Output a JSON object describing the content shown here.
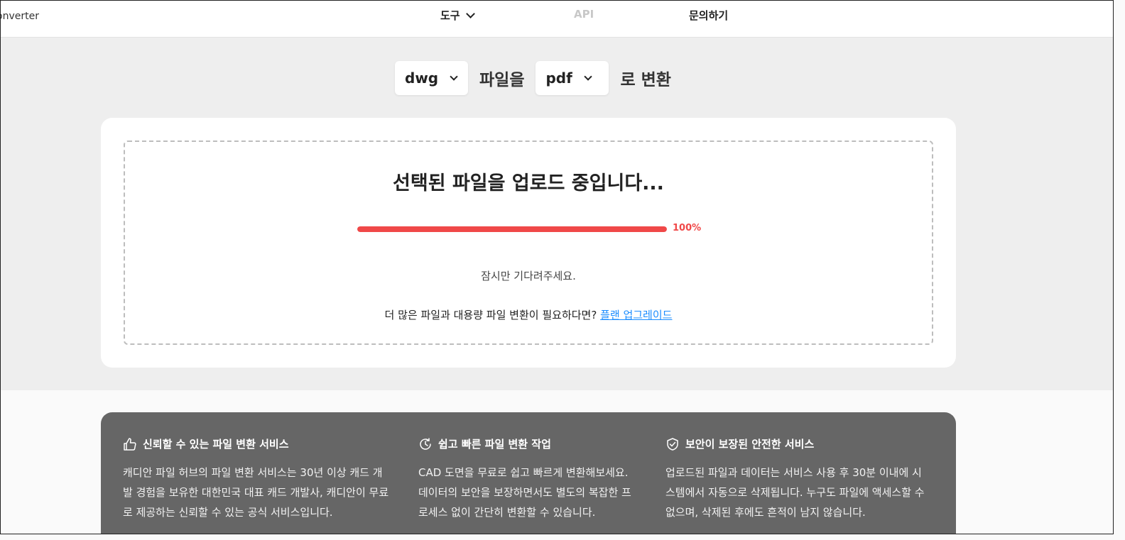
{
  "topbar": {
    "brand": "onverter",
    "nav": [
      {
        "label": "도구"
      },
      {
        "label": "API"
      },
      {
        "label": "문의하기"
      }
    ]
  },
  "converter": {
    "from_format": "dwg",
    "middle_text": "파일을",
    "to_format": "pdf",
    "suffix_text": "로 변환"
  },
  "upload": {
    "title": "선택된 파일을 업로드 중입니다...",
    "progress": 100,
    "progress_label": "100%",
    "wait_text": "잠시만 기다려주세요.",
    "upgrade_prefix": "더 많은 파일과 대용량 파일 변환이 필요하다면?",
    "upgrade_link": "플랜 업그레이드"
  },
  "colors": {
    "accent": "#f04848",
    "link": "#1a8cff",
    "feature_bg": "#666666"
  },
  "features": [
    {
      "icon": "thumbs-up-icon",
      "title": "신뢰할 수 있는 파일 변환 서비스",
      "lines": [
        "캐디안 파일 허브의 파일 변환 서비스는 30년 이상 캐드 개",
        "발 경험을 보유한 대한민국 대표 캐드 개발사, 캐디안이 무료",
        "로 제공하는 신뢰할 수 있는 공식 서비스입니다."
      ]
    },
    {
      "icon": "fast-clock-icon",
      "title": "쉽고 빠른 파일 변환 작업",
      "lines": [
        "CAD 도면을 무료로 쉽고 빠르게 변환해보세요.",
        "데이터의 보안을 보장하면서도 별도의 복잡한 프",
        "로세스 없이 간단히 변환할 수 있습니다."
      ]
    },
    {
      "icon": "shield-check-icon",
      "title": "보안이 보장된 안전한 서비스",
      "lines": [
        "업로드된 파일과 데이터는 서비스 사용 후 30분 이내에 시",
        "스템에서 자동으로 삭제됩니다. 누구도 파일에 액세스할 수",
        "없으며, 삭제된 후에도 흔적이 남지 않습니다."
      ]
    }
  ]
}
